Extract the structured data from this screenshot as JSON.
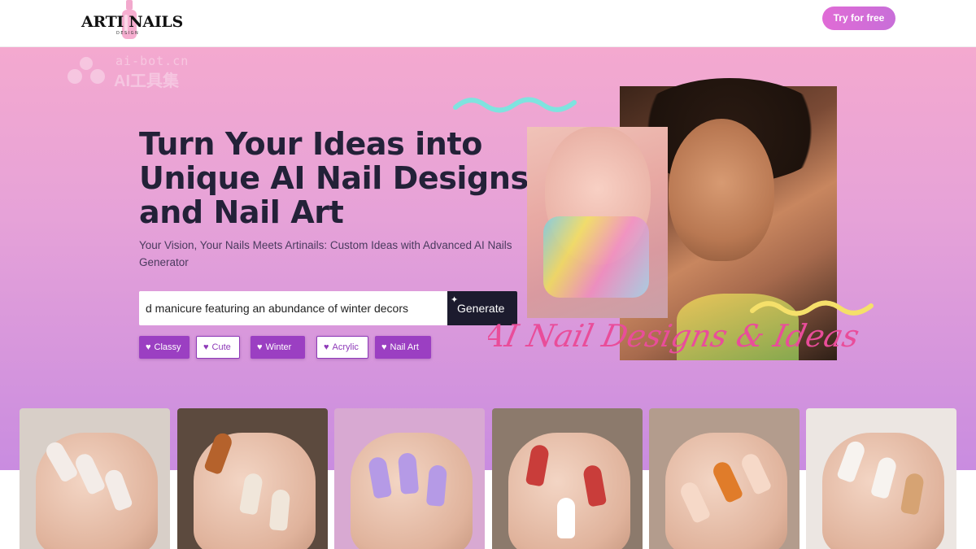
{
  "header": {
    "logo_text": "ARTI NAILS",
    "logo_sub": "DESIGN",
    "try_label": "Try for free"
  },
  "watermark": {
    "line1": "ai-bot.cn",
    "line2": "AI工具集"
  },
  "hero": {
    "title": "Turn Your Ideas into Unique AI Nail Designs and Nail Art",
    "subtitle": "Your Vision, Your Nails Meets Artinails: Custom Ideas with Advanced AI Nails Generator",
    "search_value": "d manicure featuring an abundance of winter decors",
    "generate_label": "Generate",
    "script_text": "AI Nail Designs & Ideas"
  },
  "tags": [
    {
      "label": "Classy",
      "style": "filled"
    },
    {
      "label": "Cute",
      "style": "outline"
    },
    {
      "label": "Winter",
      "style": "filled"
    },
    {
      "label": "Acrylic",
      "style": "outline"
    },
    {
      "label": "Nail Art",
      "style": "filled"
    }
  ],
  "gallery": [
    {
      "bg": "#d8cfc8",
      "nail": "#f3ece8",
      "accent": "#c9a26a"
    },
    {
      "bg": "#5c4a3e",
      "nail": "#f0e6da",
      "accent": "#b5622c"
    },
    {
      "bg": "#d8a9d2",
      "nail": "#b59ae6",
      "accent": "#ffffff"
    },
    {
      "bg": "#8c7a6c",
      "nail": "#c93d3a",
      "accent": "#ffffff"
    },
    {
      "bg": "#b39c8d",
      "nail": "#f6d9c8",
      "accent": "#e07c2a"
    },
    {
      "bg": "#ece6e2",
      "nail": "#f7f3ef",
      "accent": "#d6a373"
    }
  ],
  "colors": {
    "accent": "#9b3fc2",
    "dark": "#1c1b2e",
    "script_pink": "#e94d9a",
    "wave_teal": "#7fe3df",
    "wave_yellow": "#f5e06a"
  }
}
